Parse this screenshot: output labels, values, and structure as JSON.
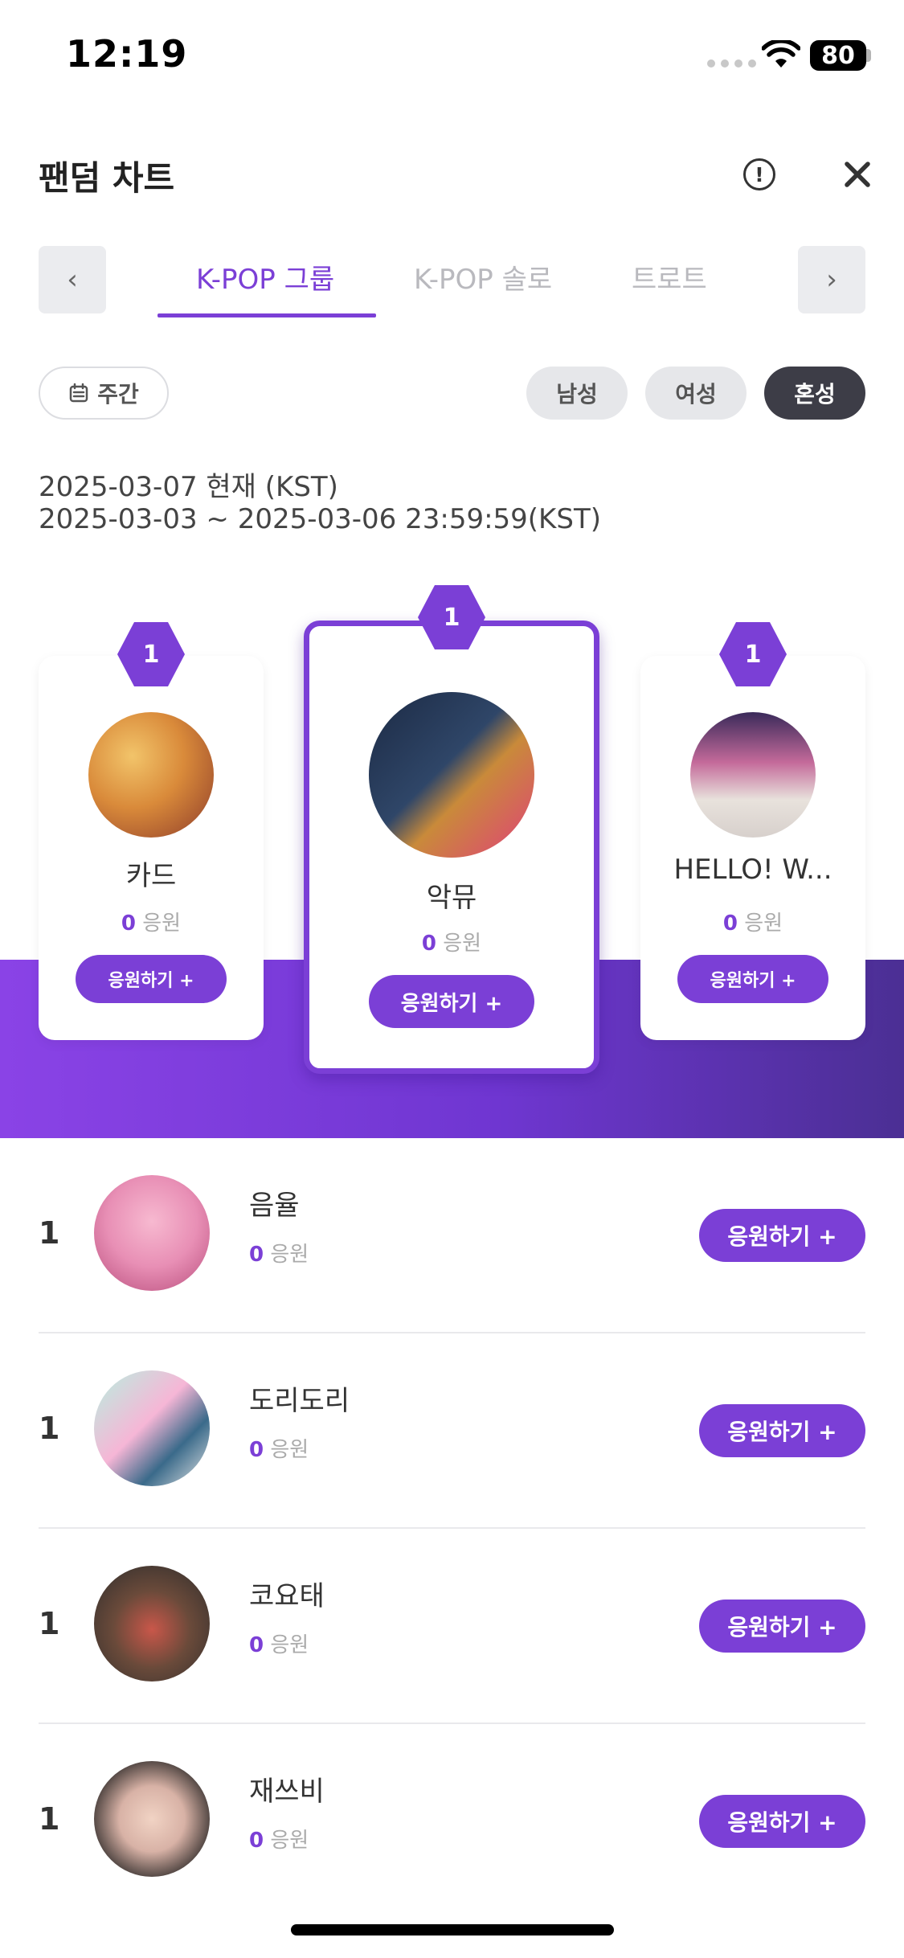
{
  "status": {
    "time": "12:19",
    "battery": "80"
  },
  "header": {
    "title": "팬덤 차트"
  },
  "tabs": [
    {
      "label": "K-POP 그룹",
      "active": true
    },
    {
      "label": "K-POP 솔로",
      "active": false
    },
    {
      "label": "트로트",
      "active": false
    }
  ],
  "nav": {
    "prev": "‹",
    "next": "›"
  },
  "filters": {
    "period": "주간",
    "genders": [
      {
        "label": "남성",
        "active": false
      },
      {
        "label": "여성",
        "active": false
      },
      {
        "label": "혼성",
        "active": true
      }
    ]
  },
  "dates": {
    "current": "2025-03-07 현재 (KST)",
    "range": "2025-03-03 ~ 2025-03-06 23:59:59(KST)"
  },
  "support_unit": "응원",
  "support_button": "응원하기 +",
  "podium": [
    {
      "rank": "1",
      "name": "카드",
      "count": "0"
    },
    {
      "rank": "1",
      "name": "악뮤",
      "count": "0"
    },
    {
      "rank": "1",
      "name": "HELLO! W...",
      "count": "0"
    }
  ],
  "list": [
    {
      "rank": "1",
      "name": "음율",
      "count": "0"
    },
    {
      "rank": "1",
      "name": "도리도리",
      "count": "0"
    },
    {
      "rank": "1",
      "name": "코요태",
      "count": "0"
    },
    {
      "rank": "1",
      "name": "재쓰비",
      "count": "0"
    }
  ],
  "colors": {
    "accent": "#7b3fd6",
    "band_start": "#8a43e6",
    "band_end": "#4b2f94"
  }
}
